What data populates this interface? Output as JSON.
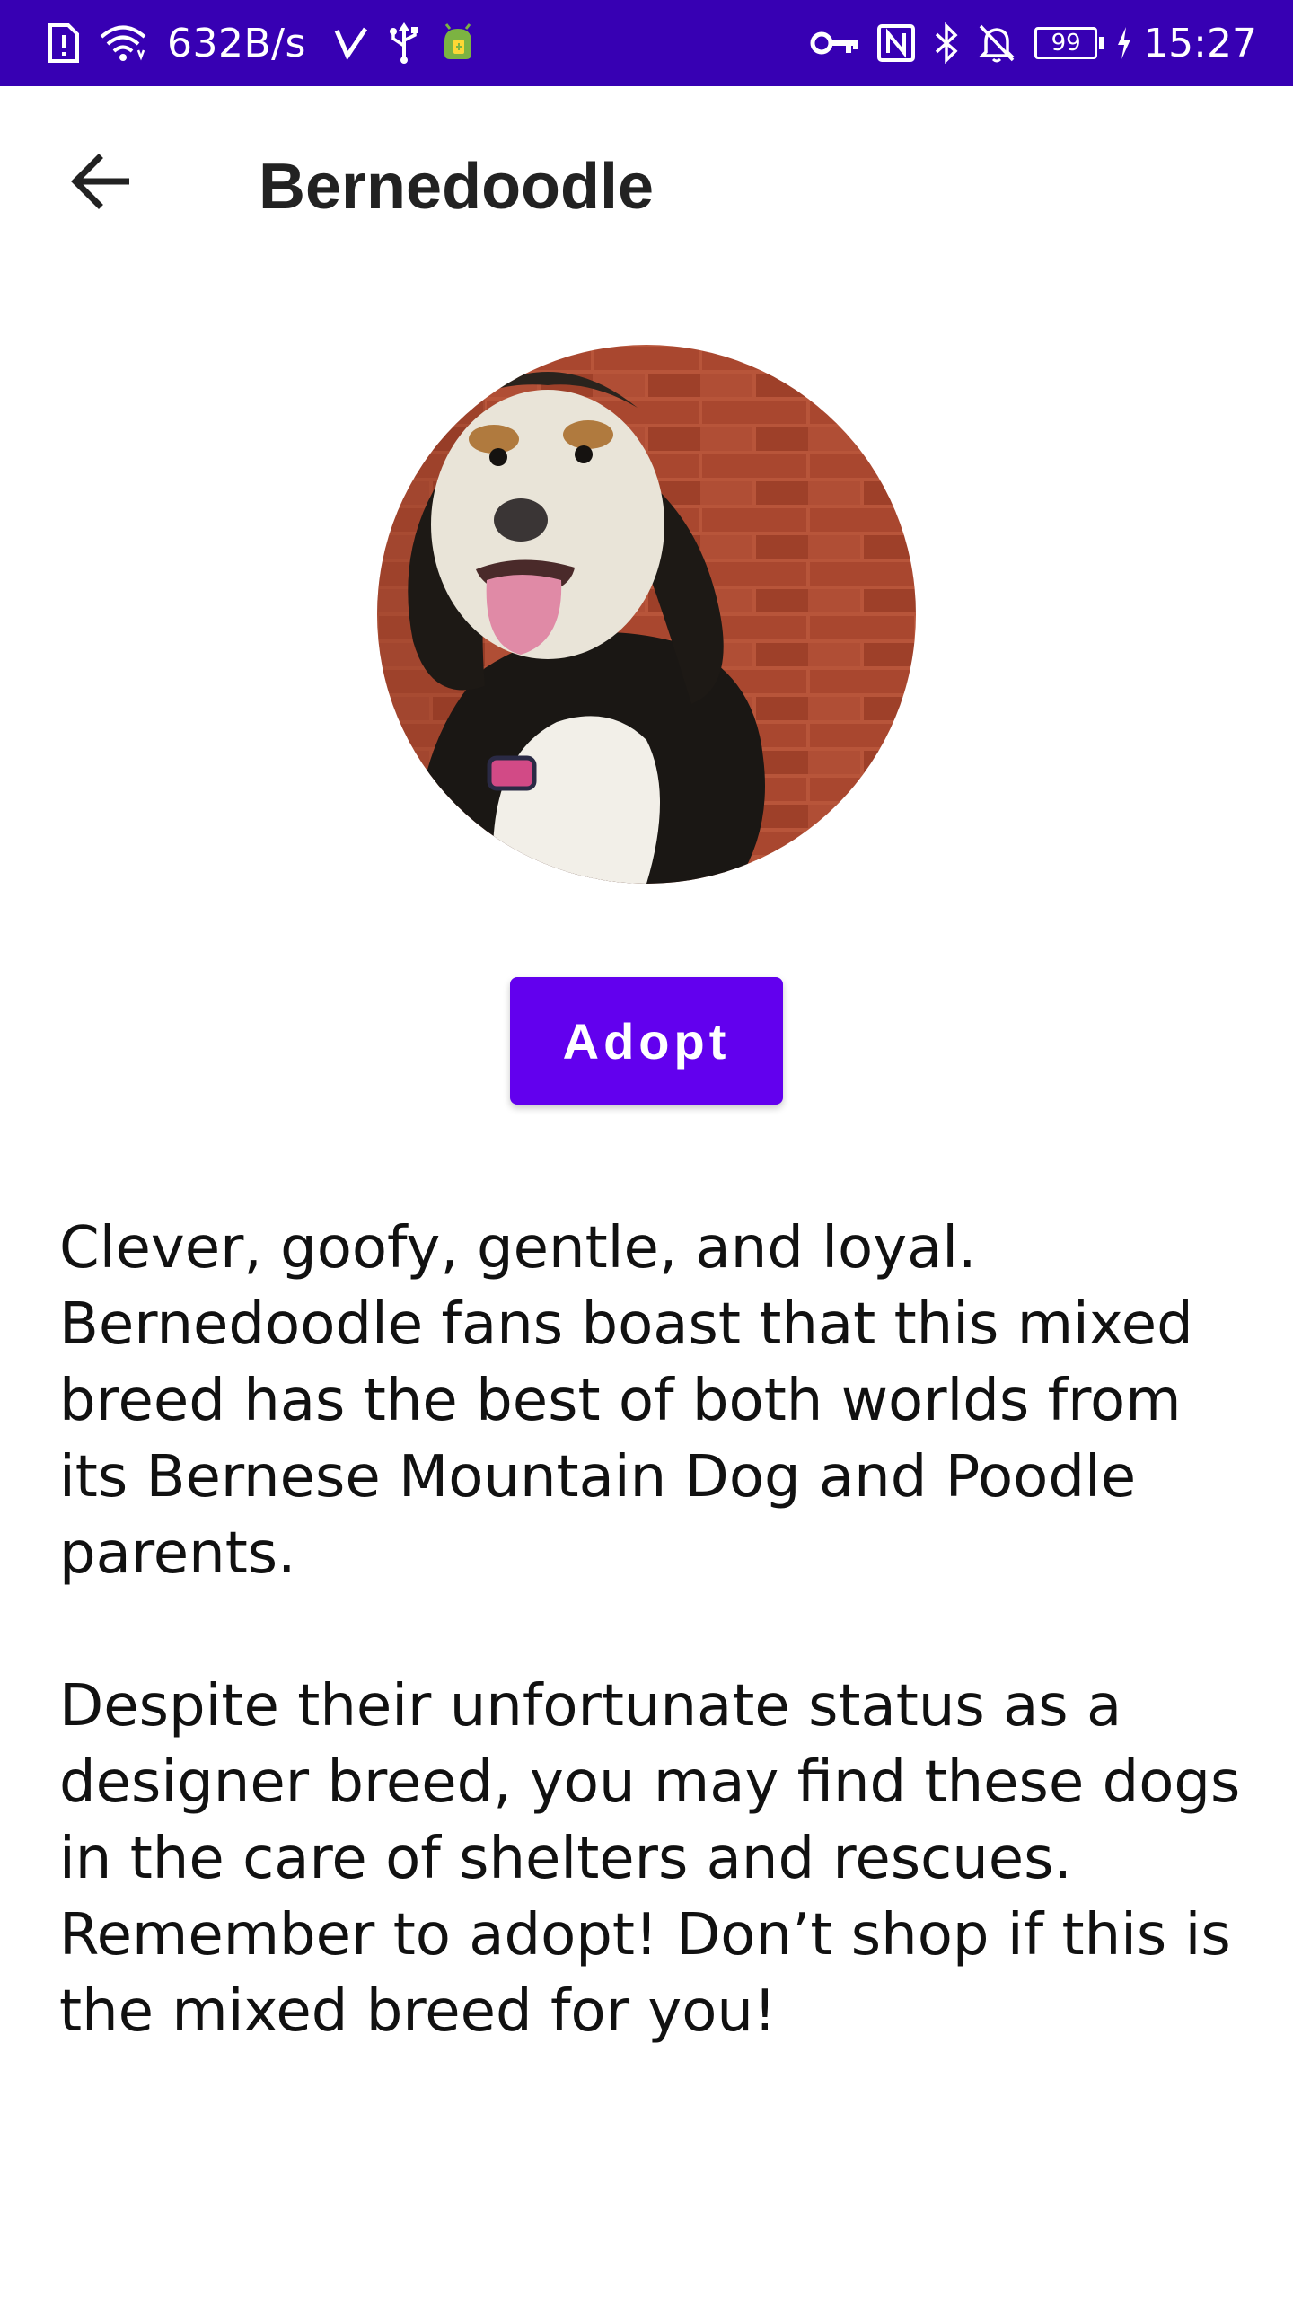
{
  "status_bar": {
    "net_speed": "632B/s",
    "battery_level": "99",
    "time": "15:27",
    "background_color": "#3700b3",
    "icons_left": [
      "sim-alert-icon",
      "wifi-icon",
      "check-icon",
      "usb-icon",
      "android-debug-icon"
    ],
    "icons_right": [
      "key-icon",
      "nfc-icon",
      "bluetooth-icon",
      "notifications-off-icon",
      "battery-icon",
      "charging-icon"
    ]
  },
  "app_bar": {
    "title": "Bernedoodle",
    "back_icon": "arrow-back-icon"
  },
  "pet": {
    "photo": "dog-photo"
  },
  "actions": {
    "adopt_label": "Adopt",
    "accent_color": "#6200ee"
  },
  "description": {
    "paragraph_1": "Clever, goofy, gentle, and loyal. Bernedoodle fans boast that this mixed breed has the best of both worlds from its Bernese Mountain Dog and Poodle parents.",
    "paragraph_2": "Despite their unfortunate status as a designer breed, you may find these dogs in the care of shelters and rescues. Remember to adopt! Don’t shop if this is the mixed breed for you!"
  }
}
